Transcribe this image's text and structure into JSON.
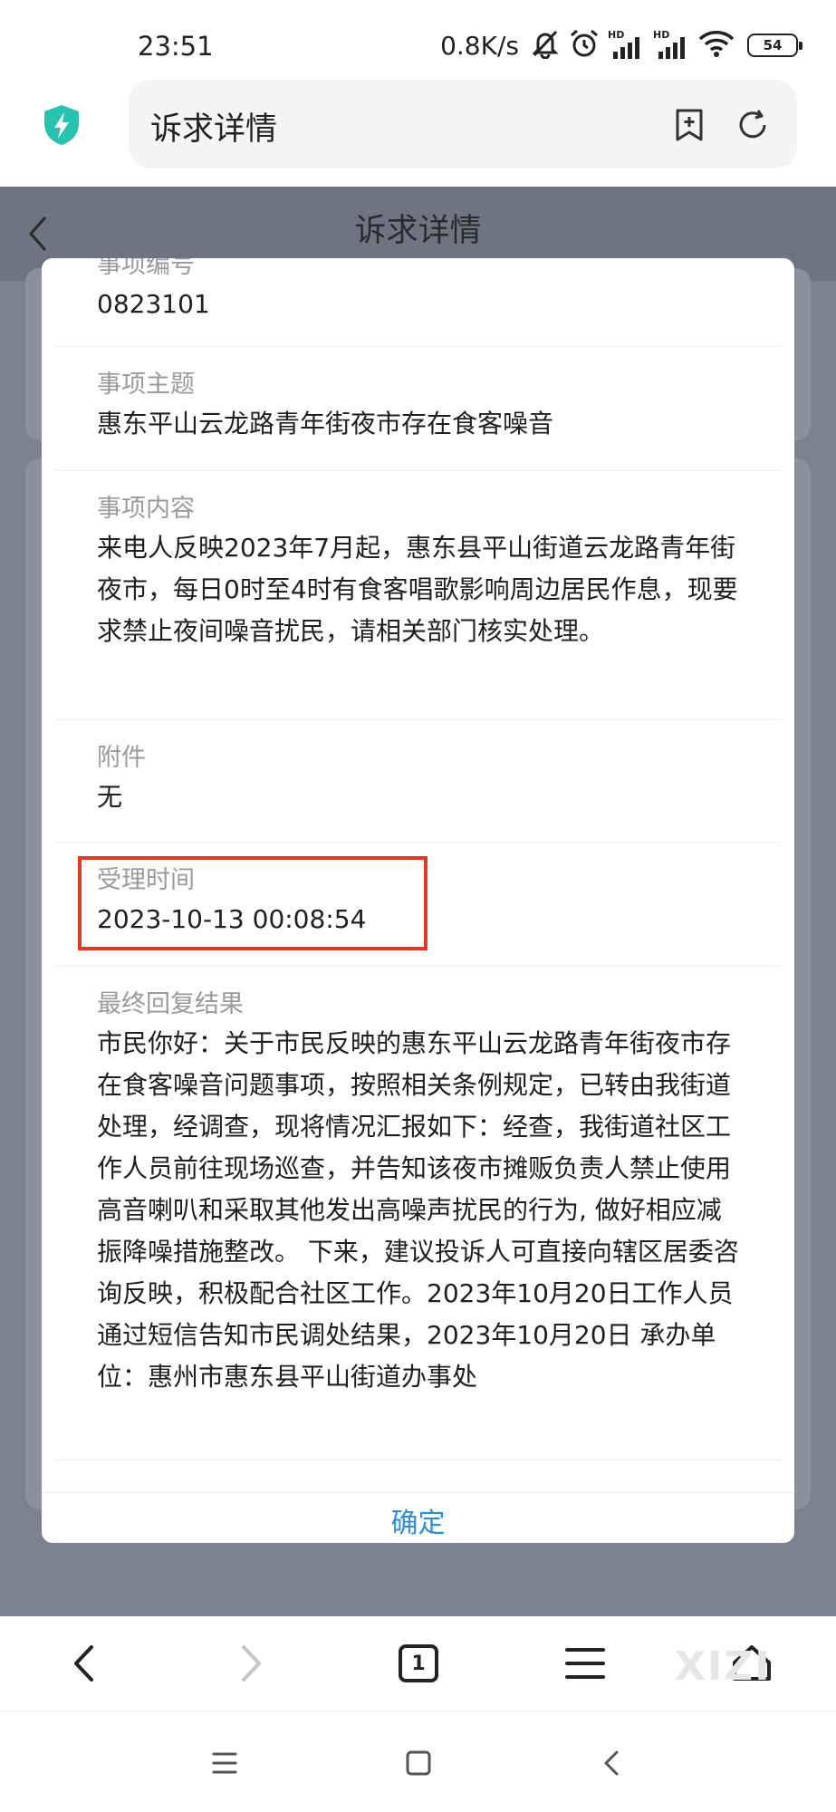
{
  "status_bar": {
    "time": "23:51",
    "net_speed": "0.8K/s",
    "battery": "54",
    "icons": [
      "mute-bell-icon",
      "alarm-icon",
      "hd-signal-icon",
      "hd-signal-icon",
      "wifi-icon",
      "battery-icon"
    ]
  },
  "browser": {
    "address_title": "诉求详情",
    "icons": [
      "shield-lightning-icon",
      "bookmark-add-icon",
      "refresh-icon"
    ]
  },
  "page": {
    "title": "诉求详情"
  },
  "modal": {
    "fields": [
      {
        "label": "事项编号",
        "value": "0823101"
      },
      {
        "label": "事项主题",
        "value": "惠东平山云龙路青年街夜市存在食客噪音"
      },
      {
        "label": "事项内容",
        "value": "来电人反映2023年7月起，惠东县平山街道云龙路青年街夜市，每日0时至4时有食客唱歌影响周边居民作息，现要求禁止夜间噪音扰民，请相关部门核实处理。"
      },
      {
        "label": "附件",
        "value": "无"
      },
      {
        "label": "受理时间",
        "value": "2023-10-13 00:08:54"
      },
      {
        "label": "最终回复结果",
        "value": "市民你好：关于市民反映的惠东平山云龙路青年街夜市存在食客噪音问题事项，按照相关条例规定，已转由我街道处理，经调查，现将情况汇报如下：经查，我街道社区工作人员前往现场巡查，并告知该夜市摊贩负责人禁止使用高音喇叭和采取其他发出高噪声扰民的行为, 做好相应减振降噪措施整改。 下来，建议投诉人可直接向辖区居委咨询反映，积极配合社区工作。2023年10月20日工作人员通过短信告知市民调处结果，2023年10月20日 承办单位：惠州市惠东县平山街道办事处"
      }
    ],
    "confirm_label": "确定",
    "highlight_color": "#de3a24",
    "confirm_color": "#2b8fd8"
  },
  "toolbar": {
    "tab_count": "1",
    "watermark": "XIZI",
    "icons": [
      "back-icon",
      "forward-icon",
      "tabs-icon",
      "menu-icon",
      "home-icon"
    ]
  },
  "system_nav": {
    "icons": [
      "recent-apps-icon",
      "home-square-icon",
      "system-back-icon"
    ]
  }
}
